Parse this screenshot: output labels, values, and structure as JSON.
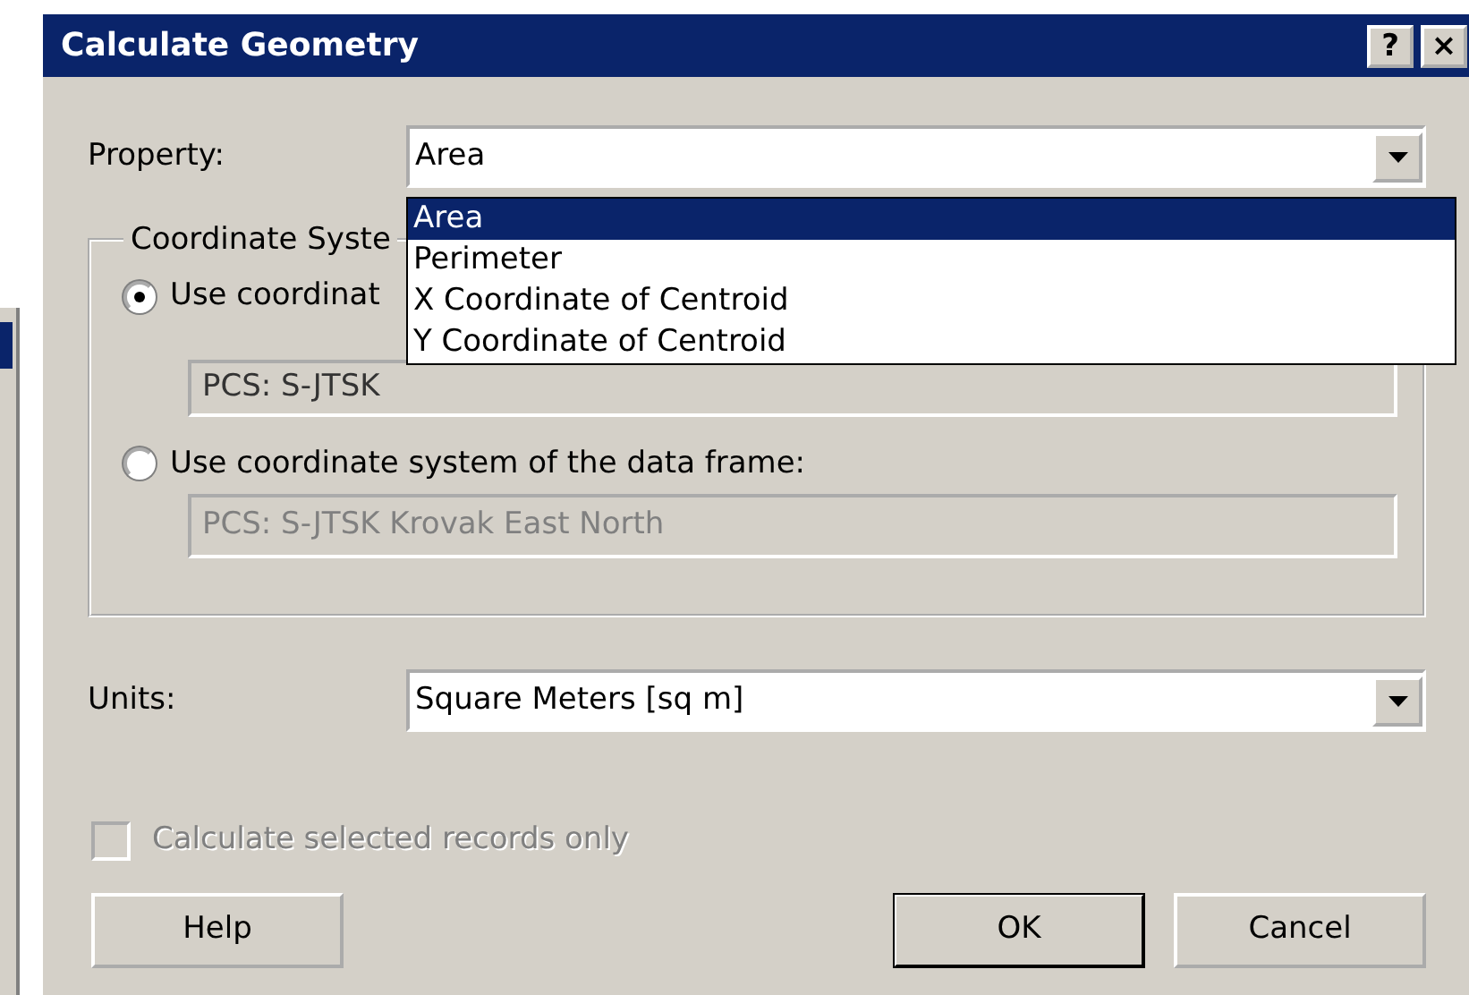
{
  "window": {
    "title": "Calculate Geometry",
    "help_button": "?",
    "close_button": "×"
  },
  "property": {
    "label": "Property:",
    "value": "Area",
    "expanded": true,
    "options": [
      {
        "label": "Area",
        "selected": true
      },
      {
        "label": "Perimeter",
        "selected": false
      },
      {
        "label": "X Coordinate of Centroid",
        "selected": false
      },
      {
        "label": "Y Coordinate of Centroid",
        "selected": false
      }
    ]
  },
  "coordinate_system": {
    "legend": "Coordinate Syste",
    "options": [
      {
        "label": "Use coordinat",
        "selected": true,
        "value": "PCS: S-JTSK"
      },
      {
        "label": "Use coordinate system of the data frame:",
        "selected": false,
        "value": "PCS: S-JTSK Krovak East North"
      }
    ]
  },
  "units": {
    "label": "Units:",
    "value": "Square Meters [sq m]"
  },
  "selected_only": {
    "label": "Calculate selected records only",
    "checked": false,
    "disabled": true
  },
  "buttons": [
    {
      "label": "Help",
      "default": false
    },
    {
      "label": "OK",
      "default": true
    },
    {
      "label": "Cancel",
      "default": false
    }
  ]
}
